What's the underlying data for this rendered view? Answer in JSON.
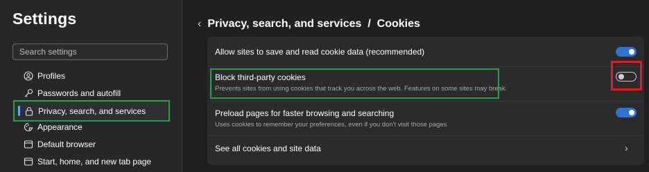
{
  "sidebar": {
    "title": "Settings",
    "search_placeholder": "Search settings",
    "items": [
      {
        "label": "Profiles",
        "icon": "profile-icon"
      },
      {
        "label": "Passwords and autofill",
        "icon": "key-icon"
      },
      {
        "label": "Privacy, search, and services",
        "icon": "lock-icon",
        "active": true
      },
      {
        "label": "Appearance",
        "icon": "appearance-icon"
      },
      {
        "label": "Default browser",
        "icon": "browser-icon"
      },
      {
        "label": "Start, home, and new tab page",
        "icon": "home-icon"
      }
    ]
  },
  "header": {
    "back_icon": "chevron-left-icon",
    "breadcrumb": "Privacy, search, and services",
    "separator": "/",
    "page": "Cookies"
  },
  "settings": [
    {
      "title": "Allow sites to save and read cookie data (recommended)",
      "description": "",
      "control": "toggle",
      "enabled": true
    },
    {
      "title": "Block third-party cookies",
      "description": "Prevents sites from using cookies that track you across the web. Features on some sites may break.",
      "control": "toggle",
      "enabled": false
    },
    {
      "title": "Preload pages for faster browsing and searching",
      "description": "Uses cookies to remember your preferences, even if you don't visit those pages",
      "control": "toggle",
      "enabled": true
    },
    {
      "title": "See all cookies and site data",
      "description": "",
      "control": "link",
      "icon": "chevron-right-icon"
    }
  ],
  "annotations": {
    "green_highlight_color": "#1fa34a",
    "red_highlight_color": "#e11b22"
  },
  "colors": {
    "accent": "#2f74d0",
    "background": "#202020",
    "sidebar": "#272727",
    "card": "#2b2b2b"
  }
}
